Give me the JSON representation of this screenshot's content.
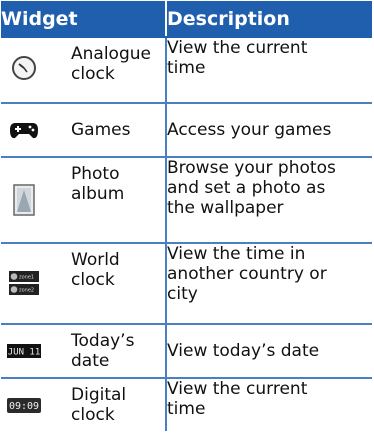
{
  "header": {
    "widget": "Widget",
    "description": "Description"
  },
  "rows": [
    {
      "icon": "analogue-clock-icon",
      "name": "Analogue\nclock",
      "description": "View the current\ntime"
    },
    {
      "icon": "gamepad-icon",
      "name": "Games",
      "description": "Access your games"
    },
    {
      "icon": "photo-album-icon",
      "name": "Photo\nalbum",
      "description": "Browse your photos\nand set a photo as\nthe wallpaper"
    },
    {
      "icon": "world-clock-icon",
      "icon_text": [
        "zone1",
        "zone2"
      ],
      "name": "World\nclock",
      "description": "View the time in\nanother country or\ncity"
    },
    {
      "icon": "date-icon",
      "icon_text": "JUN 11",
      "name": "Today’s\ndate",
      "description": "View today’s date"
    },
    {
      "icon": "digital-clock-icon",
      "icon_text": "09:09",
      "name": "Digital\nclock",
      "description": "View the current\ntime"
    }
  ],
  "colors": {
    "header_bg": "#1f5fae",
    "rule": "#4a7fc1"
  }
}
